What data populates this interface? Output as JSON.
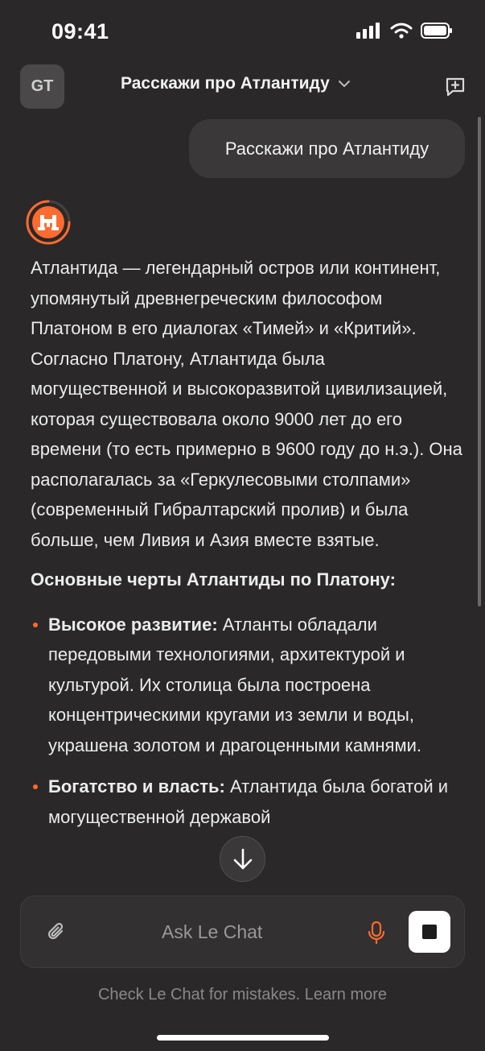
{
  "status_bar": {
    "time": "09:41"
  },
  "header": {
    "avatar_initials": "GT",
    "chat_title": "Расскажи про Атлантиду"
  },
  "user_message": "Расскажи про Атлантиду",
  "assistant": {
    "intro": "Атлантида — легендарный остров или континент, упомянутый древнегреческим философом Платоном в его диалогах «Тимей» и «Критий». Согласно Платону, Атлантида была могущественной и высокоразвитой цивилизацией, которая существовала около 9000 лет до его времени (то есть примерно в 9600 году до н.э.). Она располагалась за «Геркулесовыми столпами» (современный Гибралтарский пролив) и была больше, чем Ливия и Азия вместе взятые.",
    "heading": "Основные черты Атлантиды по Платону:",
    "bullets": [
      {
        "title": "Высокое развитие:",
        "text": " Атланты обладали передовыми технологиями, архитектурой и культурой. Их столица была построена концентрическими кругами из земли и воды, украшена золотом и драгоценными камнями."
      },
      {
        "title": "Богатство и власть:",
        "text": " Атлантида была богатой и могущественной державой"
      }
    ]
  },
  "input": {
    "placeholder": "Ask Le Chat"
  },
  "disclaimer": "Check Le Chat for mistakes. Learn more",
  "colors": {
    "background": "#2a2828",
    "accent": "#ff6a2f",
    "bubble": "#3a3838"
  },
  "icons": [
    "signal-icon",
    "wifi-icon",
    "battery-icon",
    "chevron-down-icon",
    "new-chat-icon",
    "le-chat-logo-icon",
    "arrow-down-icon",
    "paperclip-icon",
    "microphone-icon",
    "stop-icon"
  ]
}
